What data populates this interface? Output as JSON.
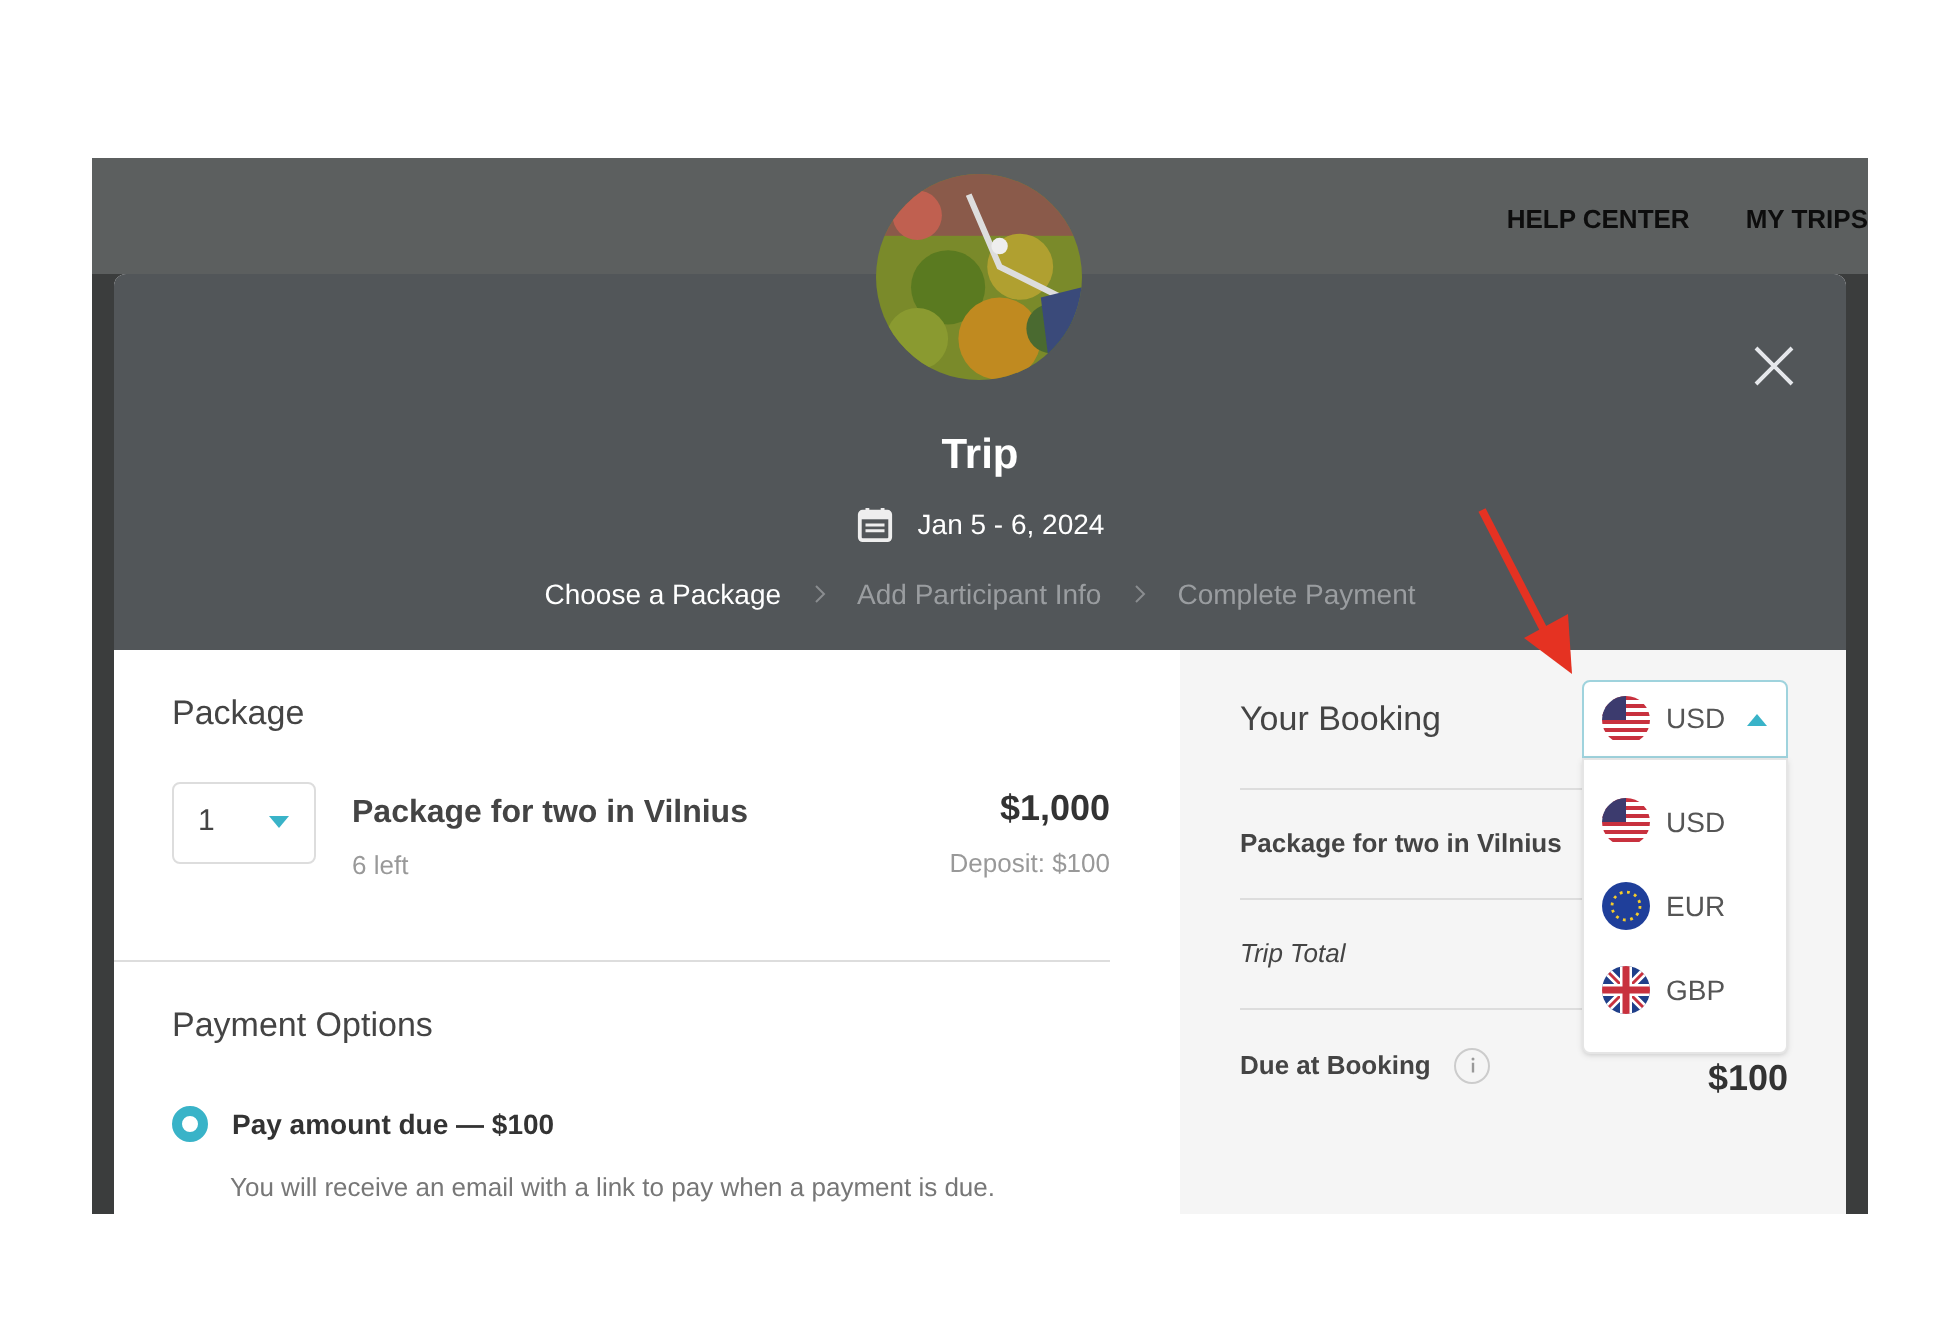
{
  "nav": {
    "links": [
      "HELP CENTER",
      "MY TRIPS"
    ]
  },
  "trip": {
    "title": "Trip",
    "dates": "Jan 5 - 6, 2024",
    "steps": [
      {
        "label": "Choose a Package",
        "selected": true
      },
      {
        "label": "Add Participant Info",
        "selected": false
      },
      {
        "label": "Complete Payment",
        "selected": false
      }
    ]
  },
  "package": {
    "heading": "Package",
    "quantity": "1",
    "name": "Package for two in Vilnius",
    "remaining": "6 left",
    "price": "$1,000",
    "deposit": "Deposit: $100"
  },
  "payment_options": {
    "heading": "Payment Options",
    "options": [
      {
        "label": "Pay amount due — $100",
        "description": "You will receive an email with a link to pay when a payment is due.",
        "selected": true
      }
    ]
  },
  "booking": {
    "heading": "Your Booking",
    "currency": {
      "value": "USD",
      "kind": "us",
      "expanded": true,
      "options": [
        {
          "code": "USD",
          "kind": "us"
        },
        {
          "code": "EUR",
          "kind": "eu"
        },
        {
          "code": "GBP",
          "kind": "gb"
        }
      ]
    },
    "rows": [
      {
        "kind": "item",
        "label": "Package for two in Vilnius"
      },
      {
        "kind": "total",
        "label": "Trip Total"
      },
      {
        "kind": "due",
        "label": "Due at Booking",
        "value": "$100"
      }
    ]
  }
}
